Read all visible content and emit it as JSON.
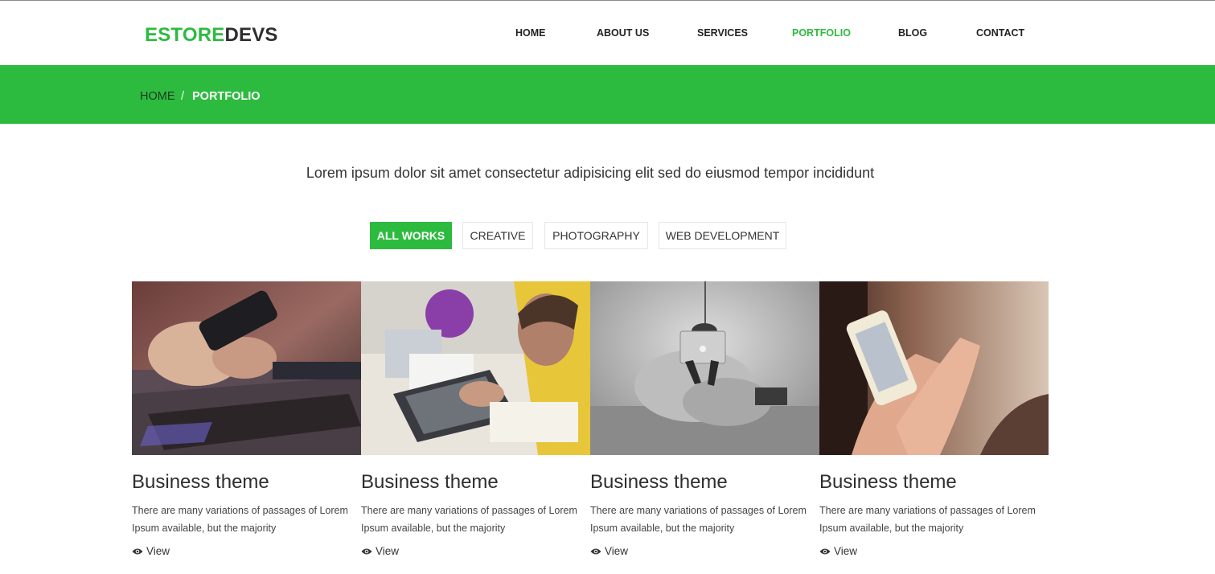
{
  "brand": {
    "part1": "ESTORE",
    "part2": "DEVS"
  },
  "nav": [
    "HOME",
    "ABOUT US",
    "SERVICES",
    "PORTFOLIO",
    "BLOG",
    "CONTACT"
  ],
  "nav_active": "PORTFOLIO",
  "breadcrumb": {
    "home": "HOME",
    "separator": "/",
    "current": "PORTFOLIO"
  },
  "intro": "Lorem ipsum dolor sit amet consectetur adipisicing elit sed do eiusmod tempor incididunt",
  "filters": [
    "ALL WORKS",
    "CREATIVE",
    "PHOTOGRAPHY",
    "WEB DEVELOPMENT"
  ],
  "filter_active": "ALL WORKS",
  "cards": [
    {
      "title": "Business theme",
      "text": "There are many variations of passages of Lorem Ipsum available, but the majority",
      "view": "View",
      "image": "hands-phone-laptop-photo"
    },
    {
      "title": "Business theme",
      "text": "There are many variations of passages of Lorem Ipsum available, but the majority",
      "view": "View",
      "image": "man-drawing-tablet-photo"
    },
    {
      "title": "Business theme",
      "text": "There are many variations of passages of Lorem Ipsum available, but the majority",
      "view": "View",
      "image": "person-beanbag-laptop-photo"
    },
    {
      "title": "Business theme",
      "text": "There are many variations of passages of Lorem Ipsum available, but the majority",
      "view": "View",
      "image": "hands-smartphone-photo"
    }
  ],
  "colors": {
    "accent": "#2dbb3f",
    "text": "#333333",
    "heading": "#2e2e2e"
  }
}
